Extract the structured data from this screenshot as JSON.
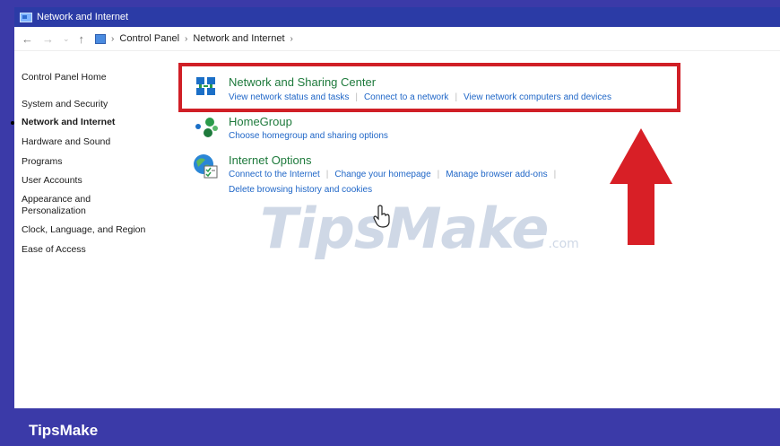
{
  "window": {
    "title": "Network and Internet",
    "breadcrumb": [
      "Control Panel",
      "Network and Internet"
    ]
  },
  "sidebar": {
    "items": [
      {
        "label": "Control Panel Home"
      },
      {
        "label": "System and Security"
      },
      {
        "label": "Network and Internet",
        "active": true
      },
      {
        "label": "Hardware and Sound"
      },
      {
        "label": "Programs"
      },
      {
        "label": "User Accounts"
      },
      {
        "label": "Appearance and Personalization"
      },
      {
        "label": "Clock, Language, and Region"
      },
      {
        "label": "Ease of Access"
      }
    ]
  },
  "categories": [
    {
      "title": "Network and Sharing Center",
      "icon": "network-sharing-icon",
      "links": [
        "View network status and tasks",
        "Connect to a network",
        "View network computers and devices"
      ]
    },
    {
      "title": "HomeGroup",
      "icon": "homegroup-icon",
      "links": [
        "Choose homegroup and sharing options"
      ]
    },
    {
      "title": "Internet Options",
      "icon": "internet-options-icon",
      "links": [
        "Connect to the Internet",
        "Change your homepage",
        "Manage browser add-ons",
        "Delete browsing history and cookies"
      ]
    }
  ],
  "watermark": {
    "main": "TipsMake",
    "suffix": ".com"
  },
  "footer": {
    "brand": "TipsMake"
  },
  "colors": {
    "highlight": "#d01f26",
    "arrow": "#d81f26",
    "link": "#1f66c7",
    "category_title": "#1e7a3c",
    "footer_bg": "#3b3aa8"
  }
}
